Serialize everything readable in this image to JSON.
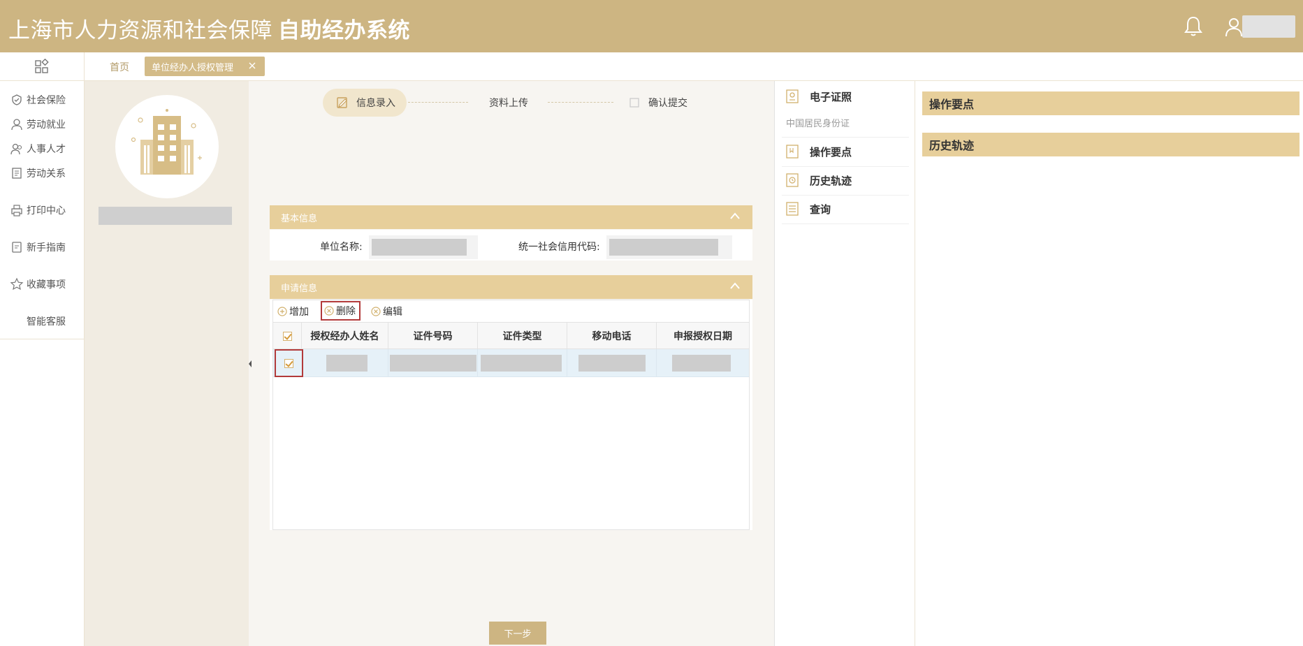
{
  "header": {
    "title": "上海市人力资源和社会保障",
    "subtitle": "自助经办系统"
  },
  "tabs": {
    "home": "首页",
    "active": "单位经办人授权管理"
  },
  "nav": {
    "items": [
      "社会保险",
      "劳动就业",
      "人事人才",
      "劳动关系",
      "打印中心",
      "新手指南",
      "收藏事项",
      "智能客服"
    ]
  },
  "steps": [
    "信息录入",
    "资料上传",
    "确认提交"
  ],
  "basic_info": {
    "title": "基本信息",
    "unit_name_label": "单位名称:",
    "credit_code_label": "统一社会信用代码:"
  },
  "apply_info": {
    "title": "申请信息",
    "toolbar": {
      "add": "增加",
      "delete": "删除",
      "edit": "编辑"
    },
    "columns": [
      "授权经办人姓名",
      "证件号码",
      "证件类型",
      "移动电话",
      "申报授权日期"
    ]
  },
  "next_button": "下一步",
  "right_menu": {
    "ecert": "电子证照",
    "ecert_sub": "中国居民身份证",
    "points": "操作要点",
    "history": "历史轨迹",
    "query": "查询"
  },
  "far_right": {
    "points": "操作要点",
    "history": "历史轨迹"
  },
  "colors": {
    "brand": "#cdb582",
    "panel_header": "#e7cf9b",
    "highlight_border": "#b23a3a"
  }
}
